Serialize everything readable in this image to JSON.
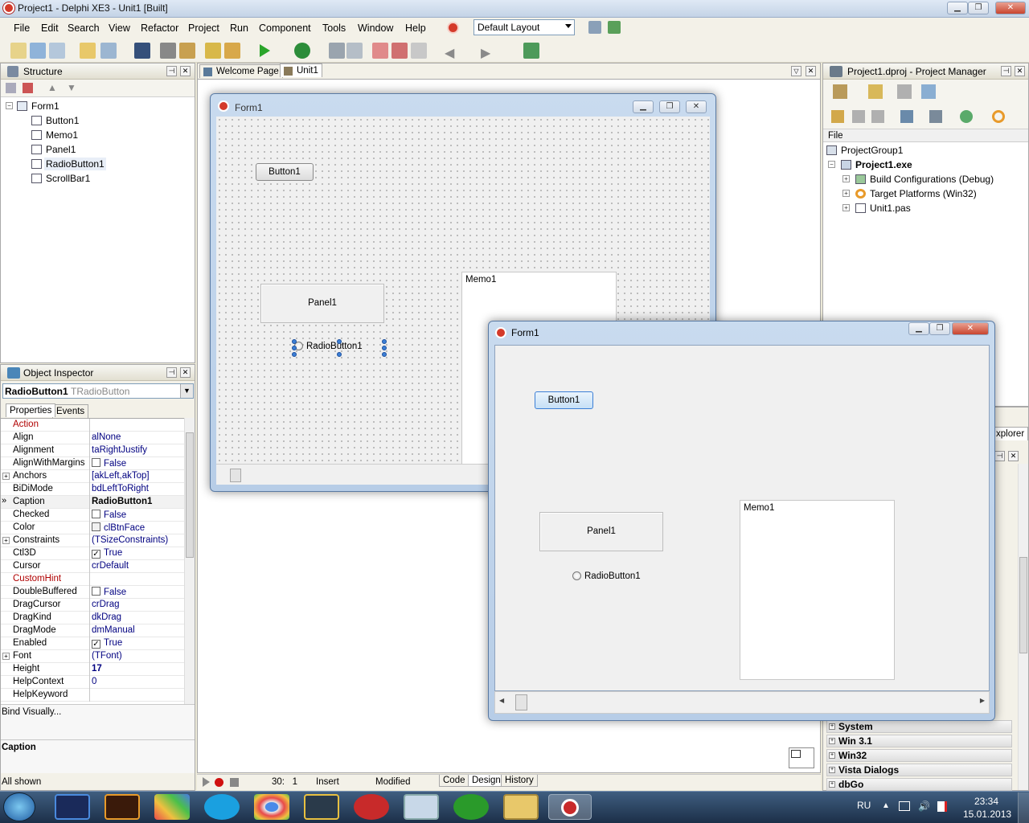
{
  "window": {
    "title": "Project1 - Delphi XE3 - Unit1 [Built]"
  },
  "menu": [
    "File",
    "Edit",
    "Search",
    "View",
    "Refactor",
    "Project",
    "Run",
    "Component",
    "Tools",
    "Window",
    "Help"
  ],
  "layout_combo": "Default Layout",
  "structure": {
    "title": "Structure",
    "root": "Form1",
    "items": [
      "Button1",
      "Memo1",
      "Panel1",
      "RadioButton1",
      "ScrollBar1"
    ]
  },
  "object_inspector": {
    "title": "Object Inspector",
    "selected_name": "RadioButton1",
    "selected_type": "TRadioButton",
    "tabs": [
      "Properties",
      "Events"
    ],
    "rows": [
      {
        "name": "Action",
        "value": ""
      },
      {
        "name": "Align",
        "value": "alNone"
      },
      {
        "name": "Alignment",
        "value": "taRightJustify"
      },
      {
        "name": "AlignWithMargins",
        "value": "False"
      },
      {
        "name": "Anchors",
        "value": "[akLeft,akTop]"
      },
      {
        "name": "BiDiMode",
        "value": "bdLeftToRight"
      },
      {
        "name": "Caption",
        "value": "RadioButton1"
      },
      {
        "name": "Checked",
        "value": "False"
      },
      {
        "name": "Color",
        "value": "clBtnFace"
      },
      {
        "name": "Constraints",
        "value": "(TSizeConstraints)"
      },
      {
        "name": "Ctl3D",
        "value": "True"
      },
      {
        "name": "Cursor",
        "value": "crDefault"
      },
      {
        "name": "CustomHint",
        "value": ""
      },
      {
        "name": "DoubleBuffered",
        "value": "False"
      },
      {
        "name": "DragCursor",
        "value": "crDrag"
      },
      {
        "name": "DragKind",
        "value": "dkDrag"
      },
      {
        "name": "DragMode",
        "value": "dmManual"
      },
      {
        "name": "Enabled",
        "value": "True"
      },
      {
        "name": "Font",
        "value": "(TFont)"
      },
      {
        "name": "Height",
        "value": "17"
      },
      {
        "name": "HelpContext",
        "value": "0"
      },
      {
        "name": "HelpKeyword",
        "value": ""
      }
    ],
    "bind_visually": "Bind Visually...",
    "description": "Caption",
    "footer": "All shown"
  },
  "editor_tabs": [
    "Welcome Page",
    "Unit1"
  ],
  "designer": {
    "form_caption": "Form1",
    "button": "Button1",
    "panel": "Panel1",
    "memo": "Memo1",
    "radio": "RadioButton1"
  },
  "status": {
    "position": "30:   1",
    "mode": "Insert",
    "state": "Modified",
    "view_tabs": [
      "Code",
      "Design",
      "History"
    ]
  },
  "project_manager": {
    "title": "Project1.dproj - Project Manager",
    "column": "File",
    "group": "ProjectGroup1",
    "project": "Project1.exe",
    "children": [
      "Build Configurations (Debug)",
      "Target Platforms (Win32)",
      "Unit1.pas"
    ],
    "partial_tab": "xplorer"
  },
  "palette_categories": [
    "System",
    "Win 3.1",
    "Win32",
    "Vista Dialogs",
    "dbGo"
  ],
  "running_form": {
    "caption": "Form1",
    "button": "Button1",
    "panel": "Panel1",
    "memo": "Memo1",
    "radio": "RadioButton1"
  },
  "tray": {
    "lang": "RU",
    "time": "23:34",
    "date": "15.01.2013"
  },
  "colors": {
    "accent": "#3c7fd6",
    "win_close": "#c9452f"
  }
}
